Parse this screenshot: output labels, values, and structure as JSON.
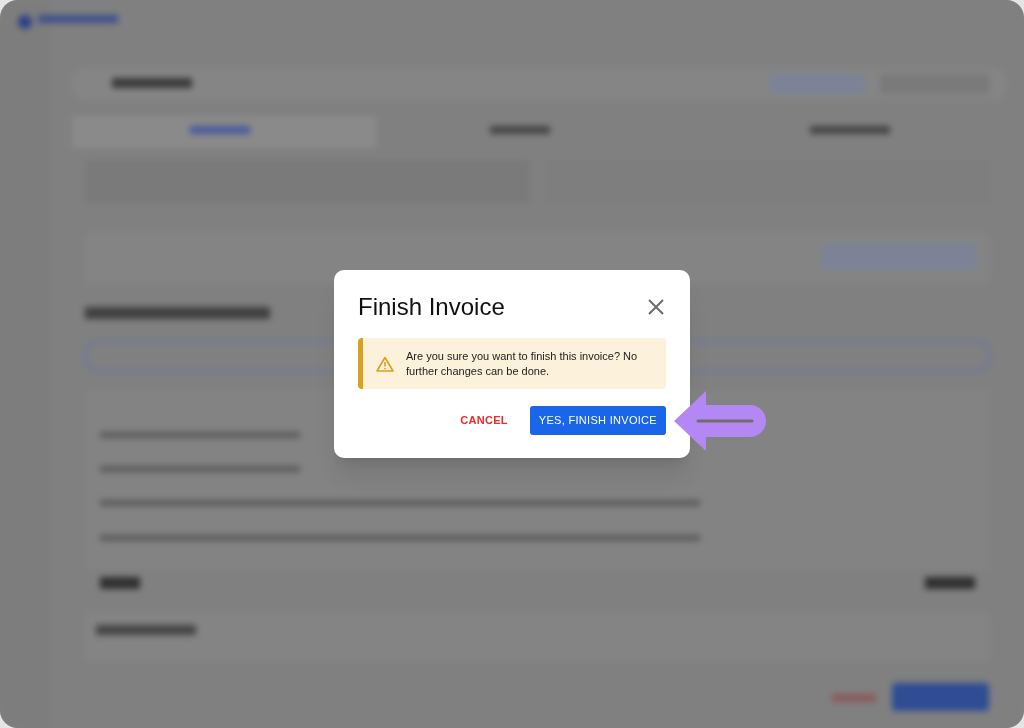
{
  "dialog": {
    "title": "Finish Invoice",
    "alert": {
      "kind": "warning",
      "message": "Are you sure you want to finish this invoice? No further changes can be done."
    },
    "buttons": [
      {
        "label": "CANCEL",
        "kind": "text"
      },
      {
        "label": "YES, FINISH INVOICE",
        "kind": "primary"
      }
    ]
  }
}
